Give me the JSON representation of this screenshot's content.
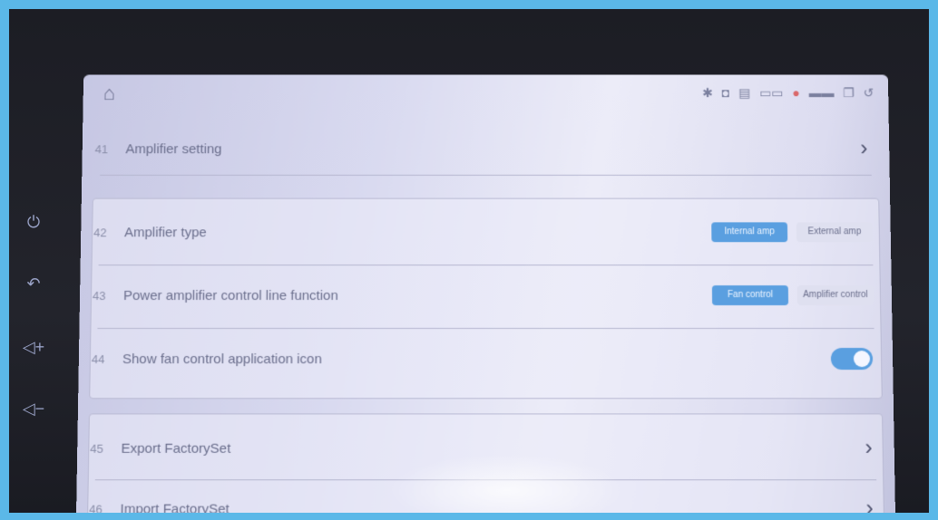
{
  "device": {
    "side_buttons": [
      {
        "icon": "power-icon",
        "glyph": "⏻"
      },
      {
        "icon": "back-icon",
        "glyph": "↶"
      },
      {
        "icon": "volume-up-icon",
        "glyph": "◁+"
      },
      {
        "icon": "volume-down-icon",
        "glyph": "◁−"
      }
    ]
  },
  "statusbar": {
    "home_icon": "home-icon",
    "icons": [
      "bluetooth-icon",
      "usb-icon",
      "sd-icon",
      "signal-icon",
      "mic-icon",
      "battery-icon",
      "window-icon",
      "back-icon"
    ]
  },
  "rows": {
    "amplifier_setting": {
      "num": "41",
      "label": "Amplifier setting"
    },
    "amplifier_type": {
      "num": "42",
      "label": "Amplifier type",
      "options": [
        "Internal amp",
        "External amp"
      ],
      "selected": 0
    },
    "power_amp_control": {
      "num": "43",
      "label": "Power amplifier control line function",
      "options": [
        "Fan control",
        "Amplifier control"
      ],
      "selected": 0
    },
    "fan_icon": {
      "num": "44",
      "label": "Show fan control application icon",
      "enabled": true
    },
    "export_factory": {
      "num": "45",
      "label": "Export FactorySet"
    },
    "import_factory": {
      "num": "46",
      "label": "Import FactorySet"
    }
  },
  "colors": {
    "accent": "#5a9fe0",
    "frame": "#5bb8e8"
  }
}
